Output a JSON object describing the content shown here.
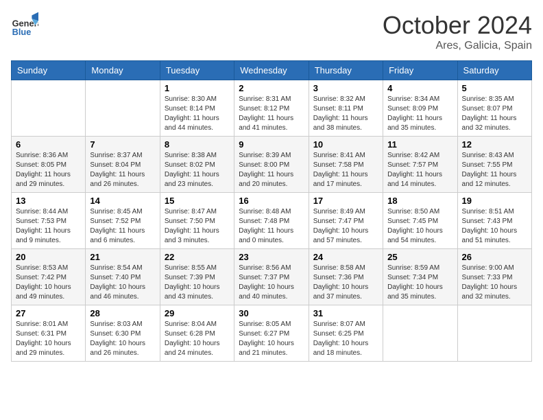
{
  "header": {
    "logo": {
      "general": "General",
      "blue": "Blue"
    },
    "title": "October 2024",
    "location": "Ares, Galicia, Spain"
  },
  "calendar": {
    "days_of_week": [
      "Sunday",
      "Monday",
      "Tuesday",
      "Wednesday",
      "Thursday",
      "Friday",
      "Saturday"
    ],
    "weeks": [
      [
        {
          "day": "",
          "info": ""
        },
        {
          "day": "",
          "info": ""
        },
        {
          "day": "1",
          "info": "Sunrise: 8:30 AM\nSunset: 8:14 PM\nDaylight: 11 hours and 44 minutes."
        },
        {
          "day": "2",
          "info": "Sunrise: 8:31 AM\nSunset: 8:12 PM\nDaylight: 11 hours and 41 minutes."
        },
        {
          "day": "3",
          "info": "Sunrise: 8:32 AM\nSunset: 8:11 PM\nDaylight: 11 hours and 38 minutes."
        },
        {
          "day": "4",
          "info": "Sunrise: 8:34 AM\nSunset: 8:09 PM\nDaylight: 11 hours and 35 minutes."
        },
        {
          "day": "5",
          "info": "Sunrise: 8:35 AM\nSunset: 8:07 PM\nDaylight: 11 hours and 32 minutes."
        }
      ],
      [
        {
          "day": "6",
          "info": "Sunrise: 8:36 AM\nSunset: 8:05 PM\nDaylight: 11 hours and 29 minutes."
        },
        {
          "day": "7",
          "info": "Sunrise: 8:37 AM\nSunset: 8:04 PM\nDaylight: 11 hours and 26 minutes."
        },
        {
          "day": "8",
          "info": "Sunrise: 8:38 AM\nSunset: 8:02 PM\nDaylight: 11 hours and 23 minutes."
        },
        {
          "day": "9",
          "info": "Sunrise: 8:39 AM\nSunset: 8:00 PM\nDaylight: 11 hours and 20 minutes."
        },
        {
          "day": "10",
          "info": "Sunrise: 8:41 AM\nSunset: 7:58 PM\nDaylight: 11 hours and 17 minutes."
        },
        {
          "day": "11",
          "info": "Sunrise: 8:42 AM\nSunset: 7:57 PM\nDaylight: 11 hours and 14 minutes."
        },
        {
          "day": "12",
          "info": "Sunrise: 8:43 AM\nSunset: 7:55 PM\nDaylight: 11 hours and 12 minutes."
        }
      ],
      [
        {
          "day": "13",
          "info": "Sunrise: 8:44 AM\nSunset: 7:53 PM\nDaylight: 11 hours and 9 minutes."
        },
        {
          "day": "14",
          "info": "Sunrise: 8:45 AM\nSunset: 7:52 PM\nDaylight: 11 hours and 6 minutes."
        },
        {
          "day": "15",
          "info": "Sunrise: 8:47 AM\nSunset: 7:50 PM\nDaylight: 11 hours and 3 minutes."
        },
        {
          "day": "16",
          "info": "Sunrise: 8:48 AM\nSunset: 7:48 PM\nDaylight: 11 hours and 0 minutes."
        },
        {
          "day": "17",
          "info": "Sunrise: 8:49 AM\nSunset: 7:47 PM\nDaylight: 10 hours and 57 minutes."
        },
        {
          "day": "18",
          "info": "Sunrise: 8:50 AM\nSunset: 7:45 PM\nDaylight: 10 hours and 54 minutes."
        },
        {
          "day": "19",
          "info": "Sunrise: 8:51 AM\nSunset: 7:43 PM\nDaylight: 10 hours and 51 minutes."
        }
      ],
      [
        {
          "day": "20",
          "info": "Sunrise: 8:53 AM\nSunset: 7:42 PM\nDaylight: 10 hours and 49 minutes."
        },
        {
          "day": "21",
          "info": "Sunrise: 8:54 AM\nSunset: 7:40 PM\nDaylight: 10 hours and 46 minutes."
        },
        {
          "day": "22",
          "info": "Sunrise: 8:55 AM\nSunset: 7:39 PM\nDaylight: 10 hours and 43 minutes."
        },
        {
          "day": "23",
          "info": "Sunrise: 8:56 AM\nSunset: 7:37 PM\nDaylight: 10 hours and 40 minutes."
        },
        {
          "day": "24",
          "info": "Sunrise: 8:58 AM\nSunset: 7:36 PM\nDaylight: 10 hours and 37 minutes."
        },
        {
          "day": "25",
          "info": "Sunrise: 8:59 AM\nSunset: 7:34 PM\nDaylight: 10 hours and 35 minutes."
        },
        {
          "day": "26",
          "info": "Sunrise: 9:00 AM\nSunset: 7:33 PM\nDaylight: 10 hours and 32 minutes."
        }
      ],
      [
        {
          "day": "27",
          "info": "Sunrise: 8:01 AM\nSunset: 6:31 PM\nDaylight: 10 hours and 29 minutes."
        },
        {
          "day": "28",
          "info": "Sunrise: 8:03 AM\nSunset: 6:30 PM\nDaylight: 10 hours and 26 minutes."
        },
        {
          "day": "29",
          "info": "Sunrise: 8:04 AM\nSunset: 6:28 PM\nDaylight: 10 hours and 24 minutes."
        },
        {
          "day": "30",
          "info": "Sunrise: 8:05 AM\nSunset: 6:27 PM\nDaylight: 10 hours and 21 minutes."
        },
        {
          "day": "31",
          "info": "Sunrise: 8:07 AM\nSunset: 6:25 PM\nDaylight: 10 hours and 18 minutes."
        },
        {
          "day": "",
          "info": ""
        },
        {
          "day": "",
          "info": ""
        }
      ]
    ]
  }
}
